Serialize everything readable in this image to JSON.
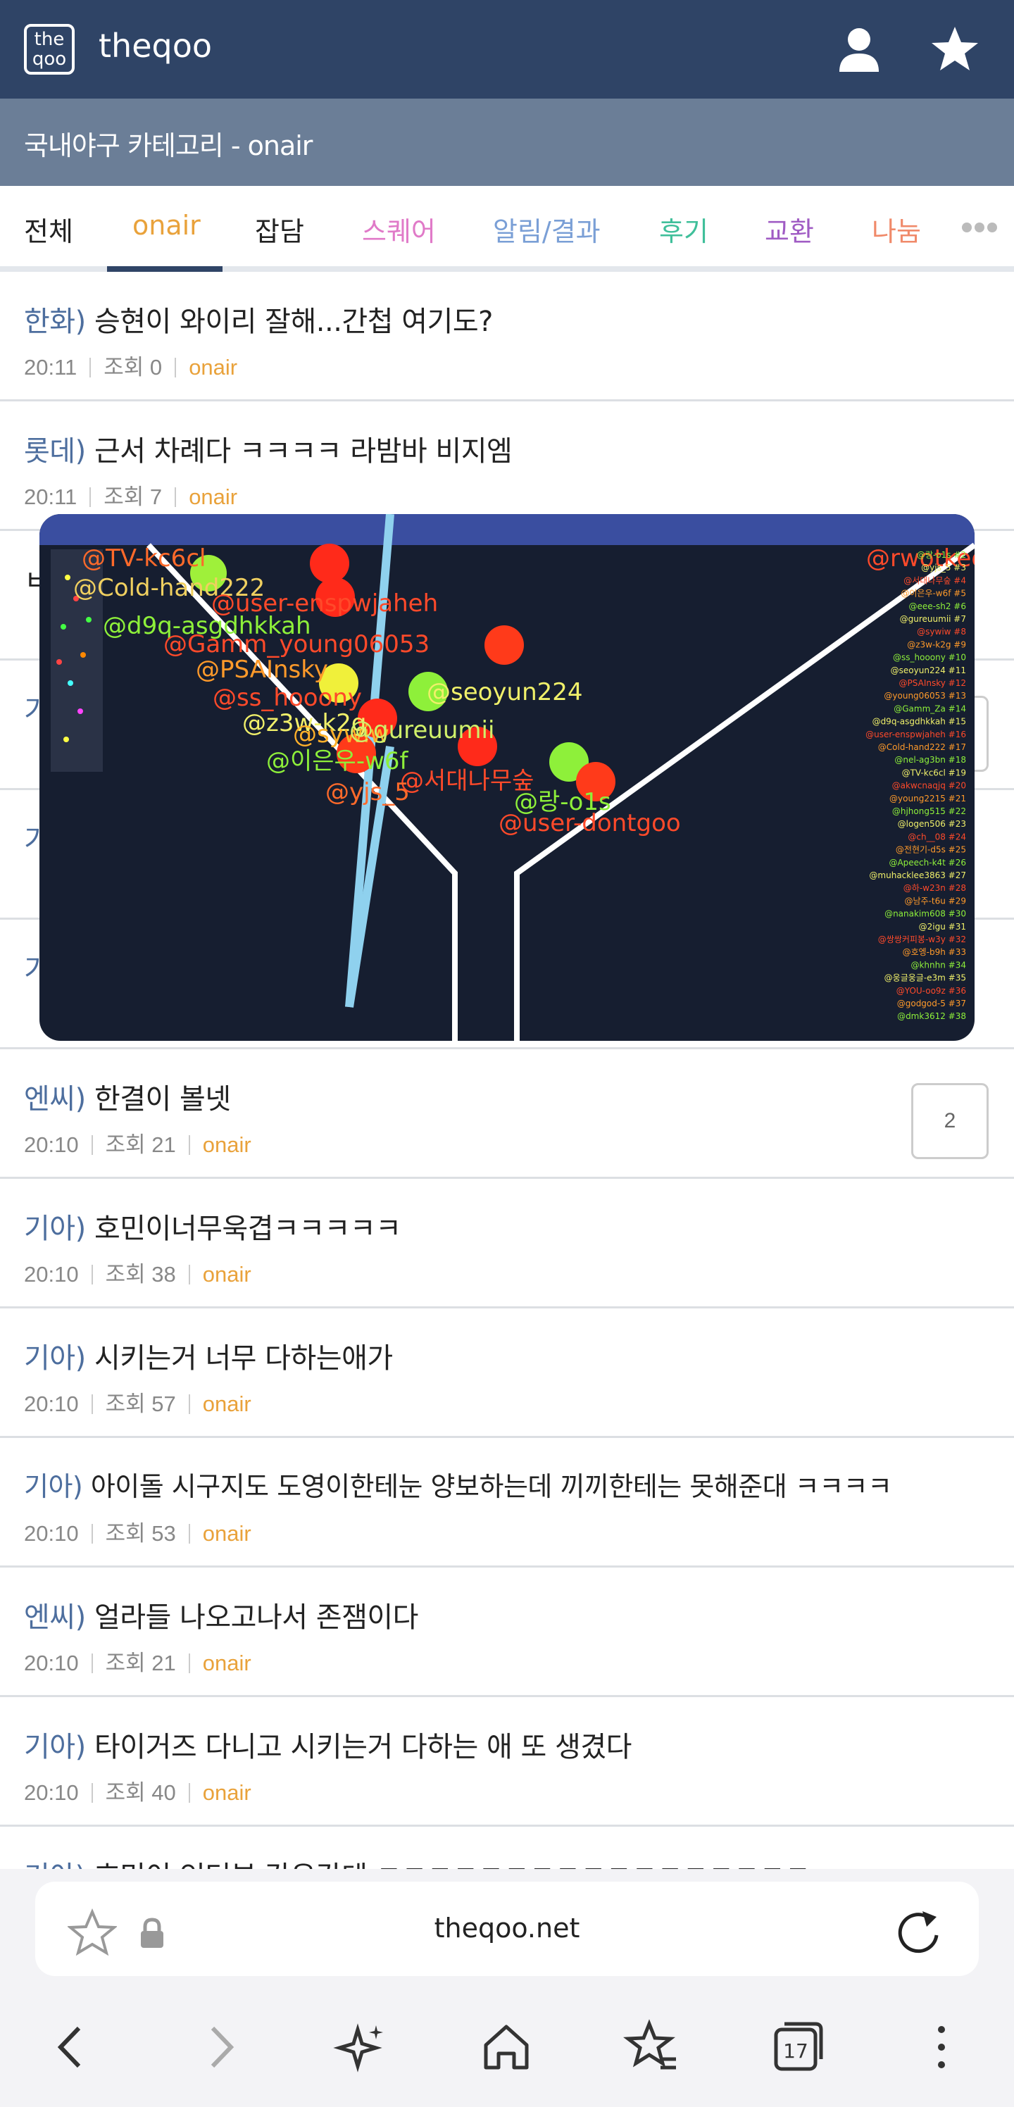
{
  "header": {
    "logo_text": "the\nqoo",
    "site_title": "theqoo",
    "user_icon": "user-icon",
    "star_icon": "star-icon"
  },
  "subheader": {
    "text": "국내야구 카테고리 - onair"
  },
  "tabs": [
    {
      "label": "전체",
      "color": "#222222"
    },
    {
      "label": "onair",
      "color": "#e9a23b",
      "active": true
    },
    {
      "label": "잡담",
      "color": "#222222"
    },
    {
      "label": "스퀘어",
      "color": "#e07ac8"
    },
    {
      "label": "알림/결과",
      "color": "#7a9fd6"
    },
    {
      "label": "후기",
      "color": "#3fbf9a"
    },
    {
      "label": "교환",
      "color": "#a05cc4"
    },
    {
      "label": "나눔",
      "color": "#f08a6a"
    }
  ],
  "posts": [
    {
      "category": "한화)",
      "title": "승현이 와이리 잘해...간첩 여기도?",
      "time": "20:11",
      "views": "조회 0",
      "board": "onair",
      "comments": ""
    },
    {
      "category": "롯데)",
      "title": "근서 차례다 ㅋㅋㅋㅋ 라밤바 비지엠",
      "time": "20:11",
      "views": "조회 7",
      "board": "onair",
      "comments": ""
    },
    {
      "category": "엔씨)",
      "title": "한결이 볼넷",
      "time": "20:10",
      "views": "조회 21",
      "board": "onair",
      "comments": "2"
    },
    {
      "category": "기아)",
      "title": "호민이너무욱겹ㅋㅋㅋㅋㅋ",
      "time": "20:10",
      "views": "조회 38",
      "board": "onair",
      "comments": ""
    },
    {
      "category": "기아)",
      "title": "시키는거 너무 다하는애가",
      "time": "20:10",
      "views": "조회 57",
      "board": "onair",
      "comments": ""
    },
    {
      "category": "기아)",
      "title": "아이돌 시구지도 도영이한테눈 양보하는데 끼끼한테는 못해준대 ㅋㅋㅋㅋ",
      "time": "20:10",
      "views": "조회 53",
      "board": "onair",
      "comments": ""
    },
    {
      "category": "엔씨)",
      "title": "얼라들 나오고나서 존잼이다",
      "time": "20:10",
      "views": "조회 21",
      "board": "onair",
      "comments": ""
    },
    {
      "category": "기아)",
      "title": "타이거즈 다니고 시키는거 다하는 애 또 생겼다",
      "time": "20:10",
      "views": "조회 40",
      "board": "onair",
      "comments": ""
    },
    {
      "category": "기아)",
      "title": "호민이 인터뷰 강유강데 ㅋㅋㅋㅋㅋㅋㅋㅋㅋㅋㅋㅋㅋㅋㅋㅋㅋ",
      "time": "",
      "views": "",
      "board": "",
      "comments": ""
    }
  ],
  "video": {
    "names": [
      "@TV-kc6cl",
      "@Cold-hand222",
      "@user-enspwjaheh",
      "@d9q-asgdhkkah",
      "@Gamm_young06053",
      "@PSAInsky",
      "@seoyun224",
      "@ss_hooony",
      "@z3w-k2g",
      "@sywiw",
      "@gureuumii",
      "@이은우-w6f",
      "@서대나무숲",
      "@yjs_5",
      "@랑-o1s",
      "@user-dontgoo",
      "@rwotkeorg"
    ],
    "leaderboard": [
      "@랑-o1s #2",
      "@yjs_5 #3",
      "@서대나무숲 #4",
      "@이은우-w6f #5",
      "@eee-sh2 #6",
      "@gureuumii #7",
      "@sywiw #8",
      "@z3w-k2g #9",
      "@ss_hooony #10",
      "@seoyun224 #11",
      "@PSAInsky #12",
      "@young06053 #13",
      "@Gamm_Za #14",
      "@d9q-asgdhkkah #15",
      "@user-enspwjaheh #16",
      "@Cold-hand222 #17",
      "@nel-ag3bn #18",
      "@TV-kc6cl #19",
      "@akwcnaqjq #20",
      "@young2215 #21",
      "@hjhong515 #22",
      "@logen506 #23",
      "@ch__08 #24",
      "@전현기-d5s #25",
      "@Apeech-k4t #26",
      "@muhacklee3863 #27",
      "@하-w23n #28",
      "@남주-t6u #29",
      "@nanakim608 #30",
      "@2igu #31",
      "@쌍쌍커피봉-w3y #32",
      "@호엥-b9h #33",
      "@khnhn #34",
      "@웅글웅글-e3m #35",
      "@YOU-oo9z #36",
      "@godgod-5 #37",
      "@dmk3612 #38"
    ]
  },
  "browser": {
    "url": "theqoo.net",
    "tabs_count": "17",
    "bookmark_icon": "star-outline-icon",
    "lock_icon": "lock-icon",
    "reload_icon": "reload-icon"
  }
}
